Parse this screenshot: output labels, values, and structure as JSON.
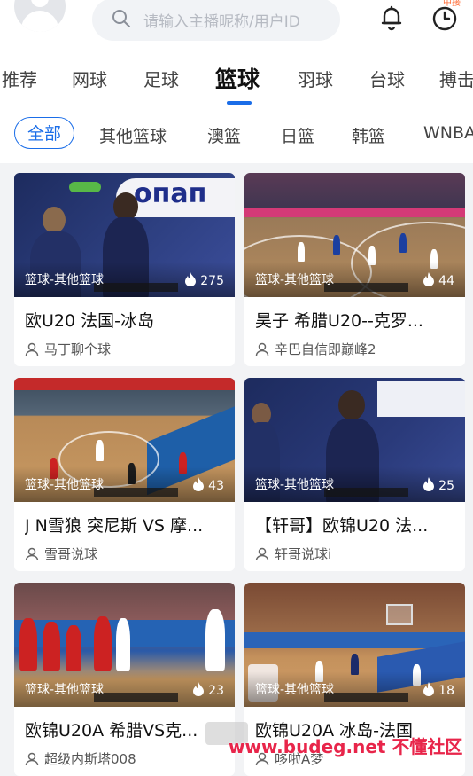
{
  "search": {
    "placeholder": "请输入主播昵称/用户ID"
  },
  "header": {
    "badge": "中接"
  },
  "categories": [
    "推荐",
    "网球",
    "足球",
    "篮球",
    "羽球",
    "台球",
    "搏击"
  ],
  "subcategories": [
    "全部",
    "其他篮球",
    "澳篮",
    "日篮",
    "韩篮",
    "WNBA"
  ],
  "cards": [
    {
      "tag": "篮球-其他篮球",
      "views": "275",
      "title": "欧U20 法国-冰岛",
      "author": "马丁聊个球"
    },
    {
      "tag": "篮球-其他篮球",
      "views": "44",
      "title": "昊子 希腊U20--克罗...",
      "author": "辛巴自信即巅峰2"
    },
    {
      "tag": "篮球-其他篮球",
      "views": "43",
      "title": "J N雪狼 突尼斯 VS 摩...",
      "author": "雪哥说球"
    },
    {
      "tag": "篮球-其他篮球",
      "views": "25",
      "title": "【轩哥】欧锦U20 法...",
      "author": "轩哥说球i"
    },
    {
      "tag": "篮球-其他篮球",
      "views": "23",
      "title": "欧锦U20A 希腊VS克...",
      "author": "超级内斯塔008"
    },
    {
      "tag": "篮球-其他篮球",
      "views": "18",
      "title": "欧锦U20A 冰岛-法国",
      "author": "哆啦A梦"
    }
  ],
  "thumb_texts": {
    "card1_sponsor": "опап"
  },
  "watermark": {
    "text": "www.budeg.net 不懂社区"
  },
  "colors": {
    "accent": "#1a6de8",
    "background": "#f2f3f5",
    "watermark": "#e8254a"
  }
}
